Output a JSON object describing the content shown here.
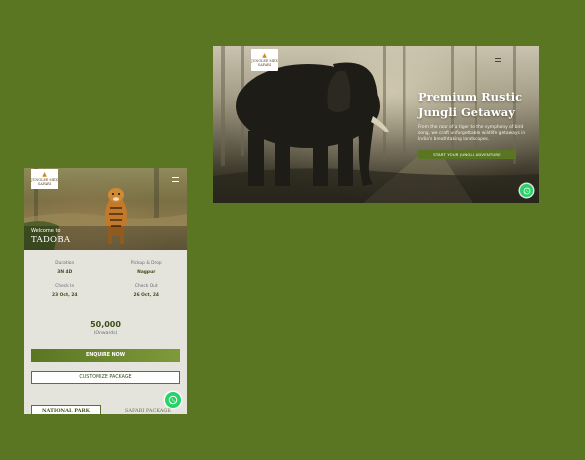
{
  "desktop": {
    "logo": {
      "brand": "JUNGLEE MEX",
      "sub": "SAFARI",
      "icon": "tiger-icon"
    },
    "hero": {
      "title_line1": "Premium Rustic",
      "title_line2": "Jungli Getaway",
      "subtitle": "From the roar of a tiger to the symphony of bird song, we craft unforgettable wildlife getaways in India's breathtaking landscapes.",
      "cta": "START YOUR JUNGLI ADVENTURE"
    },
    "whatsapp_icon": "whatsapp-icon"
  },
  "mobile": {
    "logo": {
      "brand": "JUNGLEE MEX",
      "sub": "SAFARI",
      "icon": "tiger-icon"
    },
    "welcome": "Welcome to",
    "place": "TADOBA",
    "details": {
      "duration_label": "Duration",
      "duration_value": "3N 4D",
      "pickup_label": "Pickup & Drop",
      "pickup_value": "Nagpur",
      "checkin_label": "Check In",
      "checkin_value": "23 Oct, 24",
      "checkout_label": "Check Out",
      "checkout_value": "26 Oct, 24"
    },
    "price": "50,000",
    "price_note": "(Onwards)",
    "enquire": "ENQUIRE NOW",
    "customize": "CUSTOMIZE PACKAGE",
    "tabs": [
      "NATIONAL PARK",
      "SAFARI PACKAGE"
    ]
  },
  "colors": {
    "background": "#5a7622",
    "accent": "#5a7622",
    "whatsapp": "#25d366"
  }
}
